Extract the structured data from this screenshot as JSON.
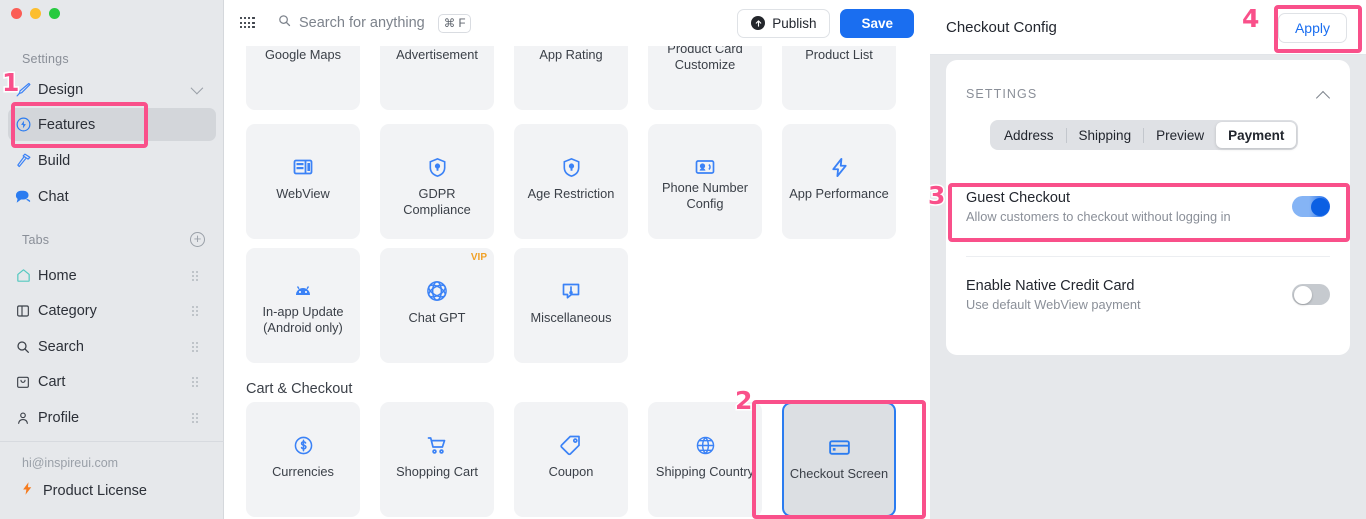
{
  "window": {
    "traffic_lights": [
      "close",
      "minimize",
      "maximize"
    ]
  },
  "sidebar": {
    "settings_caption": "Settings",
    "tabs_caption": "Tabs",
    "settings_items": [
      {
        "label": "Design",
        "icon": "brush-icon",
        "has_chevron": true,
        "active": false
      },
      {
        "label": "Features",
        "icon": "bolt-circle-icon",
        "has_chevron": false,
        "active": true
      },
      {
        "label": "Build",
        "icon": "hammer-icon",
        "has_chevron": false,
        "active": false
      },
      {
        "label": "Chat",
        "icon": "chat-bubbles-icon",
        "has_chevron": false,
        "active": false
      }
    ],
    "tab_items": [
      {
        "label": "Home",
        "icon": "home-icon"
      },
      {
        "label": "Category",
        "icon": "category-icon"
      },
      {
        "label": "Search",
        "icon": "search-icon"
      },
      {
        "label": "Cart",
        "icon": "cart-bag-icon"
      },
      {
        "label": "Profile",
        "icon": "person-icon"
      }
    ],
    "email": "hi@inspireui.com",
    "license_label": "Product License",
    "license_icon": "bolt-icon",
    "add_tab_icon": "plus-circle-icon"
  },
  "toolbar": {
    "grid_icon": "app-grid-icon",
    "search_icon": "search-icon",
    "search_placeholder": "Search for anything",
    "shortcut": "⌘ F",
    "publish_label": "Publish",
    "publish_icon": "upload-circle-icon",
    "save_label": "Save",
    "save_color": "#1a6ef0"
  },
  "features": {
    "rows": [
      [
        {
          "label": "Google Maps",
          "icon": "map-pin-icon",
          "clipped": true
        },
        {
          "label": "Advertisement",
          "icon": "megaphone-icon",
          "clipped": true
        },
        {
          "label": "App Rating",
          "icon": "star-rating-icon",
          "clipped": true
        },
        {
          "label": "Product Card\nCustomize",
          "icon": "product-card-icon",
          "clipped": true
        },
        {
          "label": "Product List",
          "icon": "list-icon",
          "clipped": true
        }
      ],
      [
        {
          "label": "WebView",
          "icon": "webview-icon"
        },
        {
          "label": "GDPR Compliance",
          "icon": "shield-lock-icon"
        },
        {
          "label": "Age Restriction",
          "icon": "shield-lock-icon"
        },
        {
          "label": "Phone Number Config",
          "icon": "contact-card-icon"
        },
        {
          "label": "App Performance",
          "icon": "bolt-icon"
        }
      ],
      [
        {
          "label": "In-app Update (Android only)",
          "icon": "android-icon"
        },
        {
          "label": "Chat GPT",
          "icon": "openai-icon",
          "badge": "VIP"
        },
        {
          "label": "Miscellaneous",
          "icon": "alert-bubble-icon"
        }
      ]
    ],
    "section_title": "Cart & Checkout",
    "cart_row": [
      {
        "label": "Currencies",
        "icon": "dollar-circle-icon"
      },
      {
        "label": "Shopping Cart",
        "icon": "shopping-cart-icon"
      },
      {
        "label": "Coupon",
        "icon": "tag-icon"
      },
      {
        "label": "Shipping Country",
        "icon": "globe-icon"
      },
      {
        "label": "Checkout Screen",
        "icon": "credit-card-icon",
        "selected": true
      }
    ]
  },
  "right_panel": {
    "title": "Checkout Config",
    "apply_label": "Apply",
    "settings_header": "SETTINGS",
    "collapse_icon": "chevron-up-icon",
    "tabs": [
      {
        "label": "Address",
        "active": false
      },
      {
        "label": "Shipping",
        "active": false
      },
      {
        "label": "Preview",
        "active": false
      },
      {
        "label": "Payment",
        "active": true
      }
    ],
    "options": [
      {
        "title": "Guest Checkout",
        "subtitle": "Allow customers to checkout without logging in",
        "state": "on"
      },
      {
        "title": "Enable Native Credit Card",
        "subtitle": "Use default WebView payment",
        "state": "off"
      }
    ]
  },
  "annotations": {
    "color": "#f9508a",
    "steps": [
      {
        "number": "1",
        "target": "sidebar-item-features"
      },
      {
        "number": "2",
        "target": "feature-card-checkout-screen"
      },
      {
        "number": "3",
        "target": "option-guest-checkout"
      },
      {
        "number": "4",
        "target": "apply-button"
      }
    ]
  }
}
